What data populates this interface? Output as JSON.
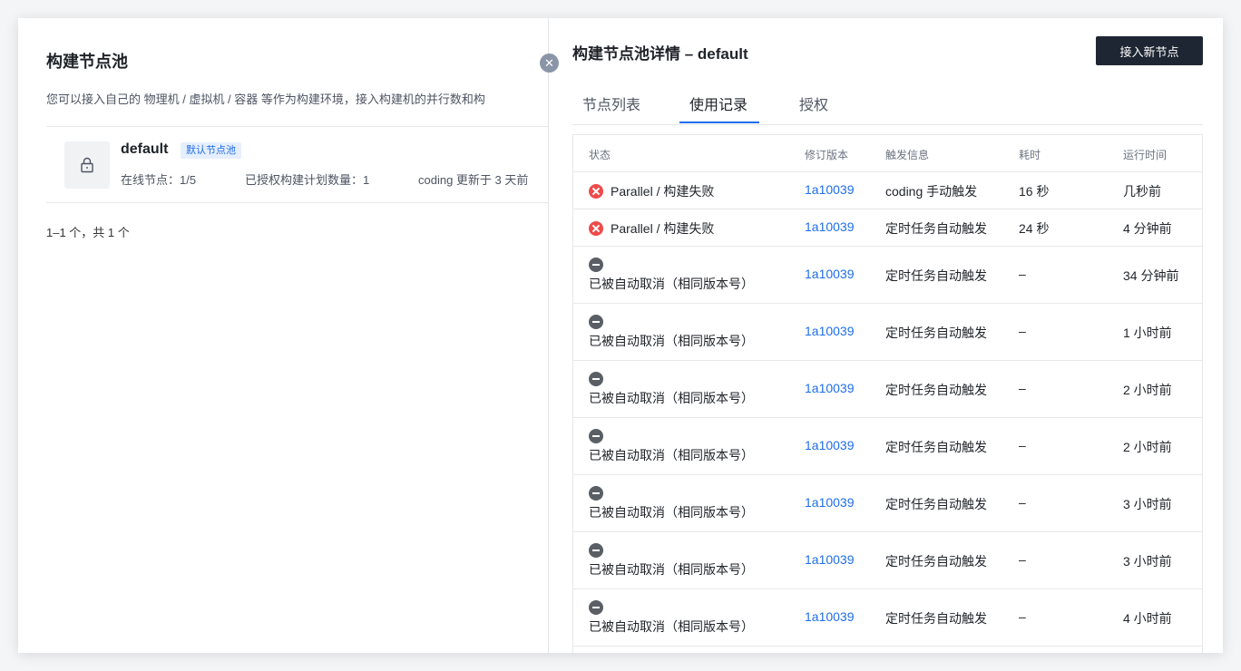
{
  "left": {
    "title": "构建节点池",
    "description": "您可以接入自己的 物理机 / 虚拟机 / 容器 等作为构建环境，接入构建机的并行数和构",
    "pool": {
      "name": "default",
      "badge": "默认节点池",
      "online_nodes": "在线节点：1/5",
      "authorized_plans": "已授权构建计划数量：1",
      "updated": "coding 更新于 3 天前"
    },
    "pagination": "1–1 个，共 1 个"
  },
  "drawer": {
    "title": "构建节点池详情 – default",
    "add_node_button": "接入新节点",
    "tabs": [
      {
        "label": "节点列表",
        "active": false
      },
      {
        "label": "使用记录",
        "active": true
      },
      {
        "label": "授权",
        "active": false
      }
    ],
    "table": {
      "headers": [
        "状态",
        "修订版本",
        "触发信息",
        "耗时",
        "运行时间"
      ],
      "rows": [
        {
          "status_type": "fail",
          "status": "Parallel / 构建失败",
          "revision": "1a10039",
          "trigger": "coding 手动触发",
          "duration": "16 秒",
          "time": "几秒前"
        },
        {
          "status_type": "fail",
          "status": "Parallel / 构建失败",
          "revision": "1a10039",
          "trigger": "定时任务自动触发",
          "duration": "24 秒",
          "time": "4 分钟前"
        },
        {
          "status_type": "cancel",
          "status": "已被自动取消（相同版本号）",
          "revision": "1a10039",
          "trigger": "定时任务自动触发",
          "duration": "–",
          "time": "34 分钟前"
        },
        {
          "status_type": "cancel",
          "status": "已被自动取消（相同版本号）",
          "revision": "1a10039",
          "trigger": "定时任务自动触发",
          "duration": "–",
          "time": "1 小时前"
        },
        {
          "status_type": "cancel",
          "status": "已被自动取消（相同版本号）",
          "revision": "1a10039",
          "trigger": "定时任务自动触发",
          "duration": "–",
          "time": "2 小时前"
        },
        {
          "status_type": "cancel",
          "status": "已被自动取消（相同版本号）",
          "revision": "1a10039",
          "trigger": "定时任务自动触发",
          "duration": "–",
          "time": "2 小时前"
        },
        {
          "status_type": "cancel",
          "status": "已被自动取消（相同版本号）",
          "revision": "1a10039",
          "trigger": "定时任务自动触发",
          "duration": "–",
          "time": "3 小时前"
        },
        {
          "status_type": "cancel",
          "status": "已被自动取消（相同版本号）",
          "revision": "1a10039",
          "trigger": "定时任务自动触发",
          "duration": "–",
          "time": "3 小时前"
        },
        {
          "status_type": "cancel",
          "status": "已被自动取消（相同版本号）",
          "revision": "1a10039",
          "trigger": "定时任务自动触发",
          "duration": "–",
          "time": "4 小时前"
        }
      ]
    }
  },
  "colors": {
    "accent": "#1f6ee8",
    "fail": "#f04a4a",
    "cancel": "#5a5f66",
    "primary_button": "#1f2633"
  },
  "icons": {
    "pool": "lock-icon",
    "close": "close-icon",
    "fail": "error-circle-icon",
    "cancel": "minus-circle-icon"
  }
}
